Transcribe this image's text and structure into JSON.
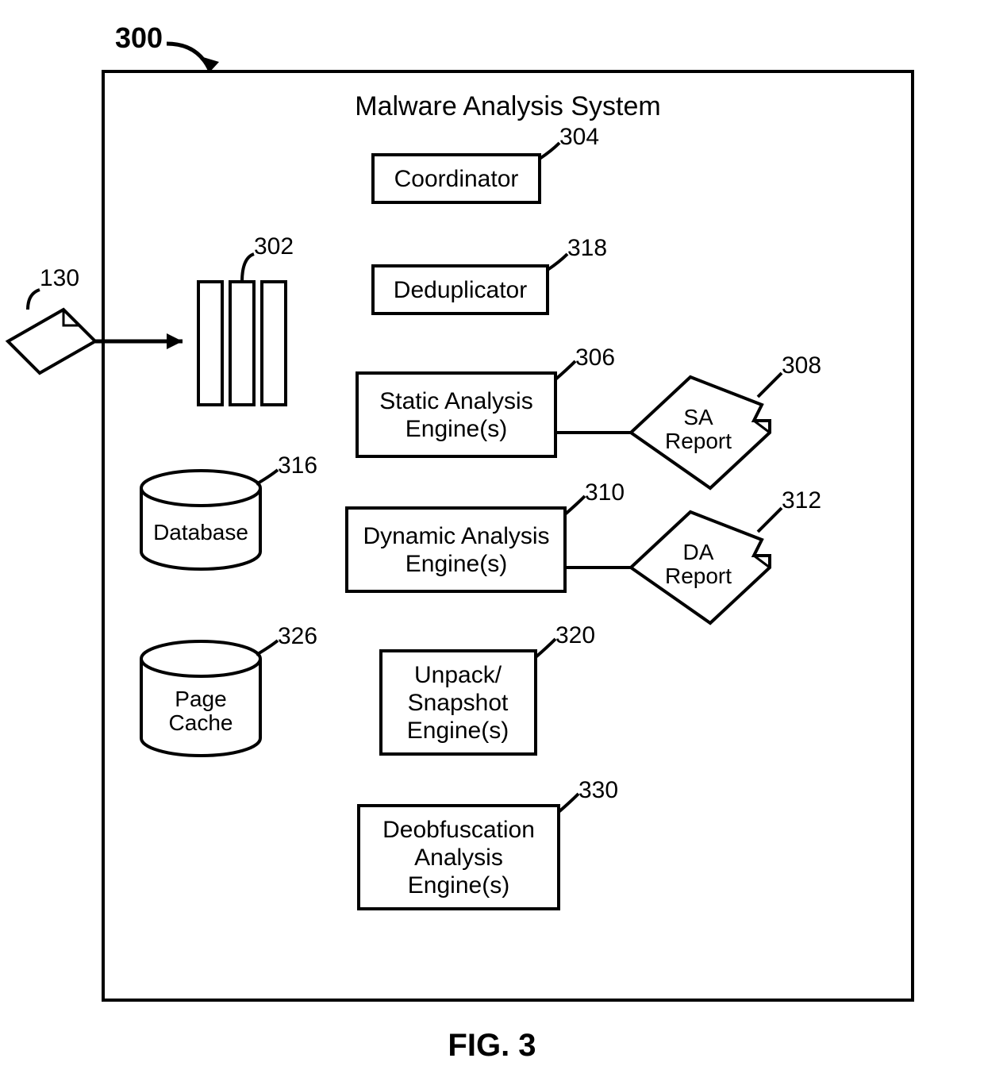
{
  "figure": {
    "num_label": "300",
    "caption": "FIG. 3",
    "title": "Malware Analysis System"
  },
  "refs": {
    "input_doc": "130",
    "queue": "302",
    "coordinator": "304",
    "static_engine": "306",
    "sa_report": "308",
    "dynamic_engine": "310",
    "da_report": "312",
    "database": "316",
    "deduplicator": "318",
    "unpack_engine": "320",
    "page_cache": "326",
    "deobf_engine": "330"
  },
  "boxes": {
    "coordinator": "Coordinator",
    "deduplicator": "Deduplicator",
    "static_l1": "Static Analysis",
    "static_l2": "Engine(s)",
    "dynamic_l1": "Dynamic Analysis",
    "dynamic_l2": "Engine(s)",
    "unpack_l1": "Unpack/",
    "unpack_l2": "Snapshot",
    "unpack_l3": "Engine(s)",
    "deobf_l1": "Deobfuscation",
    "deobf_l2": "Analysis",
    "deobf_l3": "Engine(s)"
  },
  "reports": {
    "sa_l1": "SA",
    "sa_l2": "Report",
    "da_l1": "DA",
    "da_l2": "Report"
  },
  "cyls": {
    "database": "Database",
    "page_l1": "Page",
    "page_l2": "Cache"
  }
}
